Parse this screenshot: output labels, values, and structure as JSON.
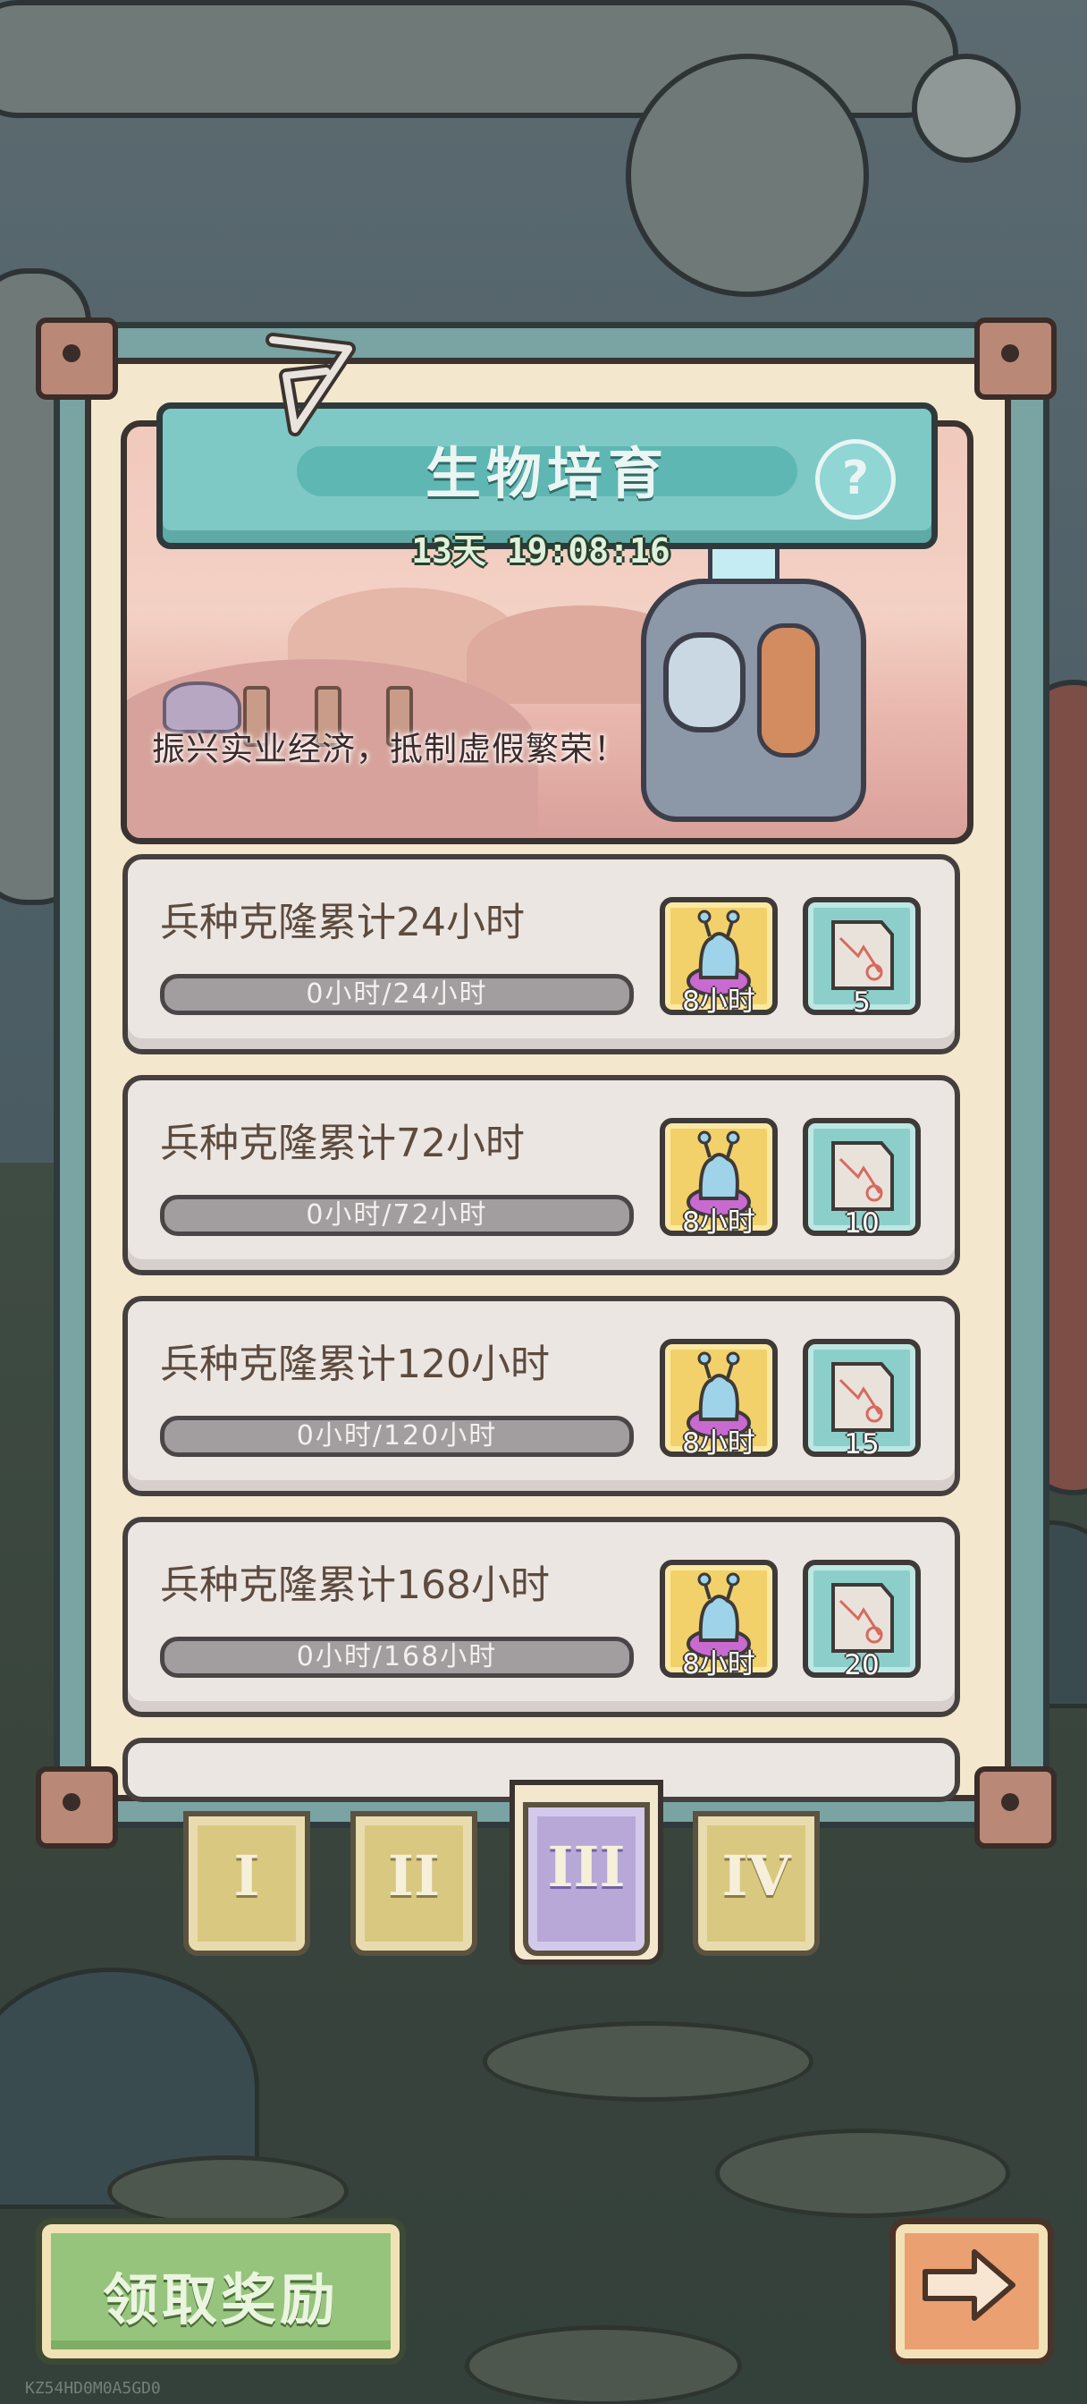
{
  "header": {
    "title": "生物培育",
    "help_symbol": "?",
    "countdown": "13天 19:08:16"
  },
  "banner": {
    "slogan": "振兴实业经济，抵制虚假繁荣！"
  },
  "tasks": [
    {
      "title": "兵种克隆累计24小时",
      "progress_text": "0小时/24小时",
      "progress": 0,
      "reward_item_label": "8小时",
      "reward_currency_amount": "5"
    },
    {
      "title": "兵种克隆累计72小时",
      "progress_text": "0小时/72小时",
      "progress": 0,
      "reward_item_label": "8小时",
      "reward_currency_amount": "10"
    },
    {
      "title": "兵种克隆累计120小时",
      "progress_text": "0小时/120小时",
      "progress": 0,
      "reward_item_label": "8小时",
      "reward_currency_amount": "15"
    },
    {
      "title": "兵种克隆累计168小时",
      "progress_text": "0小时/168小时",
      "progress": 0,
      "reward_item_label": "8小时",
      "reward_currency_amount": "20"
    }
  ],
  "tabs": [
    {
      "label": "I",
      "active": false
    },
    {
      "label": "II",
      "active": false
    },
    {
      "label": "III",
      "active": true
    },
    {
      "label": "IV",
      "active": false
    }
  ],
  "footer": {
    "claim_label": "领取奖励",
    "next_icon": "arrow-right-icon",
    "watermark": "KZ54HD0M0A5GD0"
  },
  "colors": {
    "panel_teal": "#7aa3a3",
    "parchment": "#f3e7cd",
    "reward_gold": "#f2d16b",
    "reward_teal": "#8ccfca",
    "tab_active": "#b7a8d8",
    "claim_green": "#96c47d",
    "next_orange": "#eaa071"
  }
}
